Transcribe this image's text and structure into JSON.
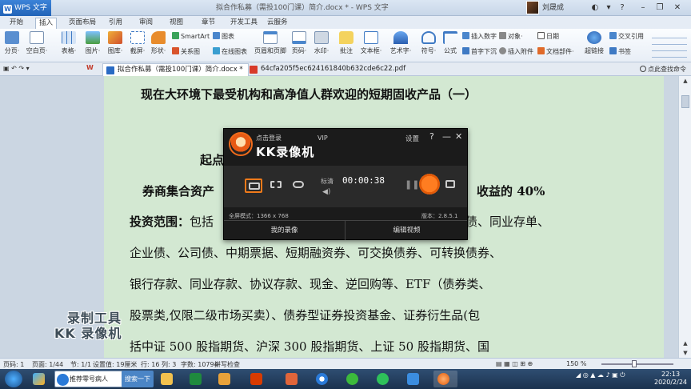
{
  "titlebar": {
    "app": "WPS 文字",
    "title": "拟合作私募（需投100门课）简介.docx * - WPS 文字",
    "user": "刘晟成"
  },
  "menu_tabs": [
    "开始",
    "插入",
    "页面布局",
    "引用",
    "审阅",
    "视图",
    "章节",
    "开发工具",
    "云服务"
  ],
  "ribbon": {
    "large": [
      {
        "label": "分页·",
        "icon": "page-break-icon"
      },
      {
        "label": "空白页·",
        "icon": "blank-page-icon"
      },
      {
        "label": "表格·",
        "icon": "table-icon"
      },
      {
        "label": "图片·",
        "icon": "picture-icon"
      },
      {
        "label": "图库·",
        "icon": "gallery-icon"
      },
      {
        "label": "截屏·",
        "icon": "screenshot-icon"
      },
      {
        "label": "形状·",
        "icon": "shape-icon"
      },
      {
        "label": "页眉和页脚",
        "icon": "header-footer-icon"
      },
      {
        "label": "页码·",
        "icon": "page-number-icon"
      },
      {
        "label": "水印·",
        "icon": "watermark-icon"
      },
      {
        "label": "批注",
        "icon": "comment-icon"
      },
      {
        "label": "文本框·",
        "icon": "textbox-icon"
      },
      {
        "label": "艺术字·",
        "icon": "wordart-icon"
      },
      {
        "label": "符号·",
        "icon": "symbol-icon"
      },
      {
        "label": "公式",
        "icon": "formula-icon"
      },
      {
        "label": "超链接",
        "icon": "hyperlink-icon"
      }
    ],
    "small": {
      "smartart": "SmartArt",
      "chart": "图表",
      "relation": "关系图",
      "online_chart": "在线图表",
      "insert_number": "插入数字",
      "object": "对象·",
      "date": "日期",
      "first_drop": "首字下沉",
      "attachment": "插入附件",
      "doc_parts": "文档部件·",
      "cross_ref": "交叉引用",
      "bookmark": "书签"
    }
  },
  "doc_tabs": [
    {
      "label": "拟合作私募（需投100门课）简介.docx *",
      "active": true
    },
    {
      "label": "64cfa205f5ec624161840b632cde6c22.pdf",
      "active": false
    }
  ],
  "doc_toolbar": {
    "quick_style": "点此查找命令"
  },
  "document": {
    "title": "现在大环境下最受机构和高净值人群欢迎的短期固收产品（一）",
    "line2_start": "起点",
    "line3_start": "券商集合资产",
    "line3_end": "收益的 40%",
    "line4_label": "投资范围：",
    "line4_start": "包括",
    "line4_end": "债、同业存单、",
    "line5": "企业债、公司债、中期票据、短期融资券、可交换债券、可转换债券、",
    "line6": "银行存款、同业存款、协议存款、现金、逆回购等、ETF（债券类、",
    "line7": "股票类,仅限二级市场买卖）、债券型证券投资基金、证券衍生品(包",
    "line8": "括中证 500 股指期货、沪深 300 股指期货、上证 50 股指期货、国"
  },
  "watermark": {
    "line1": "录制工具",
    "line2": "KK 录像机"
  },
  "recorder": {
    "login": "点击登录",
    "vip": "VIP",
    "brand": "KK录像机",
    "settings": "设置",
    "help": "?",
    "minimize": "—",
    "close": "✕",
    "quality": "标清",
    "time": "00:00:38",
    "fullscreen_mode": "全屏模式：1366 x 768",
    "version": "版本：2.8.5.1",
    "my_recordings": "我的录像",
    "edit_video": "编辑视频"
  },
  "statusbar": {
    "page": "页码: 1",
    "pages": "页面: 1/44",
    "section": "节: 1/1",
    "setting": "设置值: 19厘米",
    "row": "行: 16",
    "col": "列: 3",
    "words": "字数: 10794",
    "spell": "拼写检查",
    "zoom": "150 %"
  },
  "taskbar": {
    "search_text": "推荐零号病人",
    "search_btn": "搜索一下",
    "time": "22:13",
    "date": "2020/2/24"
  }
}
